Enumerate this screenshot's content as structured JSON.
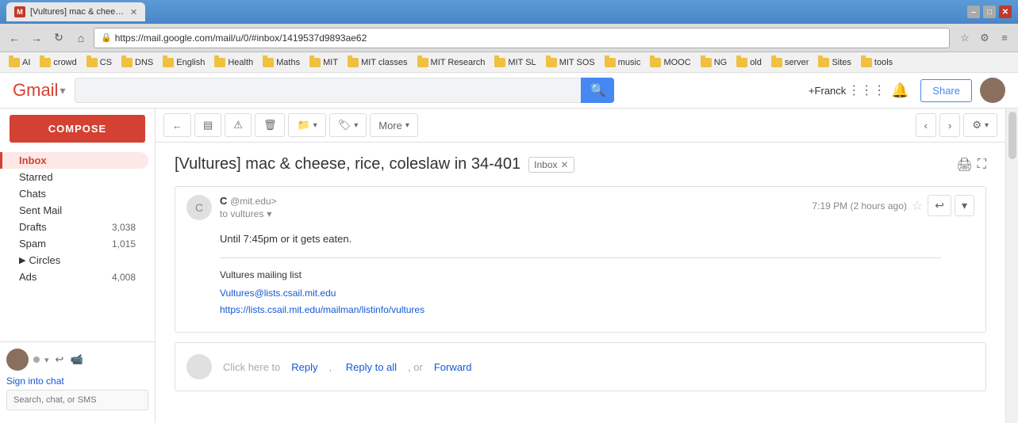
{
  "browser": {
    "tab_title": "[Vultures] mac & cheese, rice...",
    "tab_favicon": "M",
    "url": "https://mail.google.com/mail/u/0/#inbox/1419537d9893ae62",
    "win_min": "–",
    "win_max": "□",
    "win_close": "✕"
  },
  "bookmarks": {
    "items": [
      {
        "label": "AI",
        "type": "folder"
      },
      {
        "label": "crowd",
        "type": "folder"
      },
      {
        "label": "CS",
        "type": "folder"
      },
      {
        "label": "DNS",
        "type": "folder"
      },
      {
        "label": "English",
        "type": "folder"
      },
      {
        "label": "Health",
        "type": "folder"
      },
      {
        "label": "Maths",
        "type": "folder"
      },
      {
        "label": "MIT",
        "type": "folder"
      },
      {
        "label": "MIT classes",
        "type": "folder"
      },
      {
        "label": "MIT Research",
        "type": "folder"
      },
      {
        "label": "MIT SL",
        "type": "folder"
      },
      {
        "label": "MIT SOS",
        "type": "folder"
      },
      {
        "label": "music",
        "type": "folder"
      },
      {
        "label": "MOOC",
        "type": "folder"
      },
      {
        "label": "NG",
        "type": "folder"
      },
      {
        "label": "old",
        "type": "folder"
      },
      {
        "label": "server",
        "type": "folder"
      },
      {
        "label": "Sites",
        "type": "folder"
      },
      {
        "label": "tools",
        "type": "folder"
      }
    ]
  },
  "gmail": {
    "logo": "Gmail",
    "logo_caret": "▾",
    "search_placeholder": "",
    "search_btn": "🔍",
    "header": {
      "user": "+Franck",
      "share_label": "Share"
    },
    "sidebar": {
      "compose_label": "COMPOSE",
      "nav_items": [
        {
          "label": "Inbox",
          "count": "",
          "active": true
        },
        {
          "label": "Starred",
          "count": ""
        },
        {
          "label": "Chats",
          "count": ""
        },
        {
          "label": "Sent Mail",
          "count": ""
        },
        {
          "label": "Drafts",
          "count": "3,038"
        },
        {
          "label": "Spam",
          "count": "1,015"
        },
        {
          "label": "Circles",
          "count": "",
          "expandable": true
        },
        {
          "label": "Ads",
          "count": "4,008"
        }
      ],
      "chat": {
        "sign_in_label": "Sign into chat",
        "search_placeholder": "Search, chat, or SMS"
      }
    },
    "toolbar": {
      "back_btn": "←",
      "archive_btn": "🗂",
      "report_btn": "⚠",
      "delete_btn": "🗑",
      "move_btn": "📁",
      "label_btn": "🏷",
      "more_btn": "More",
      "more_caret": "▾",
      "prev_btn": "‹",
      "next_btn": "›",
      "settings_btn": "⚙",
      "settings_caret": "▾"
    },
    "email": {
      "subject": "[Vultures] mac & cheese, rice, coleslaw in 34-401",
      "inbox_badge": "Inbox",
      "badge_x": "✕",
      "print_btn": "🖨",
      "expand_btn": "⛶",
      "message": {
        "sender_initial": "C",
        "sender_name": "C",
        "sender_email": "@mit.edu>",
        "to_label": "to vultures",
        "time": "7:19 PM (2 hours ago)",
        "star": "☆",
        "body": "Until 7:45pm or it gets eaten.",
        "mailing_list_label": "Vultures mailing list",
        "mailing_list_email": "Vultures@lists.csail.mit.edu",
        "mailing_list_url": "https://lists.csail.mit.edu/mailman/listinfo/vultures"
      },
      "reply_area": {
        "text_before": "Click here to ",
        "reply_label": "Reply",
        "reply_all_label": "Reply to all",
        "or_text": ", or ",
        "forward_label": "Forward"
      }
    }
  }
}
